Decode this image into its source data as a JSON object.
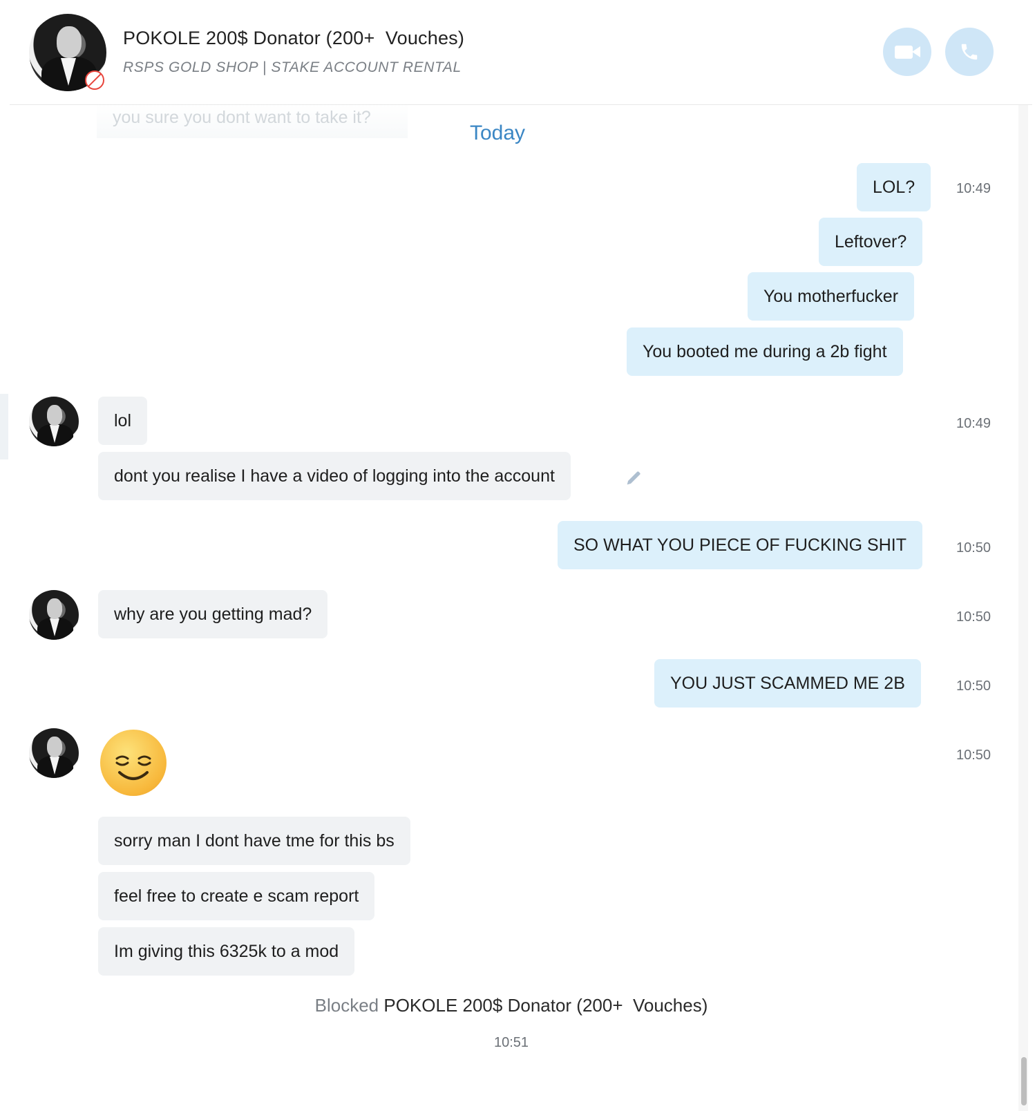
{
  "header": {
    "name": "POKOLE 200$ Donator (200+  Vouches)",
    "status": "RSPS GOLD SHOP | STAKE ACCOUNT RENTAL"
  },
  "ghost_message": "you sure you dont want to take it?",
  "date_separator": "Today",
  "messages": [
    {
      "text": "LOL?",
      "time": "10:49"
    },
    {
      "text": "Leftover?"
    },
    {
      "text": "You motherfucker"
    },
    {
      "text": "You booted me during a 2b fight"
    },
    {
      "text": "lol",
      "time": "10:49"
    },
    {
      "text": "dont you realise I have a video of logging into the account"
    },
    {
      "text": "SO WHAT YOU PIECE OF FUCKING SHIT",
      "time": "10:50"
    },
    {
      "text": "why are you getting mad?",
      "time": "10:50"
    },
    {
      "text": "YOU JUST SCAMMED ME 2B",
      "time": "10:50"
    },
    {
      "text": "relieved-face-emoji",
      "time": "10:50"
    },
    {
      "text": "sorry man I dont have tme for this bs"
    },
    {
      "text": "feel free to create e scam report"
    },
    {
      "text": "Im giving this 6325k to a mod"
    }
  ],
  "system": {
    "prefix": "Blocked",
    "name": "POKOLE 200$ Donator (200+  Vouches)",
    "time": "10:51"
  },
  "icons": {
    "video": "video-camera-icon",
    "phone": "phone-icon",
    "edit": "pencil-icon",
    "blocked": "blocked-icon"
  },
  "colors": {
    "outgoing_bubble": "#dcf0fb",
    "incoming_bubble": "#f0f2f4",
    "accent": "#3a86c4",
    "call_buttons": "#cfe6f7"
  }
}
